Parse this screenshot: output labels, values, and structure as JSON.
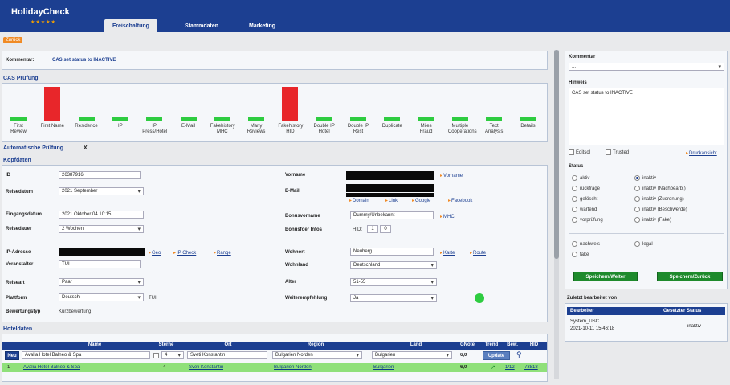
{
  "app": {
    "logo": "HolidayCheck",
    "logo_stars": "★★★★★"
  },
  "tabs": [
    "Freischaltung",
    "Stammdaten",
    "Marketing"
  ],
  "back_label": "Zurück",
  "comment_bar": {
    "label": "Kommentar:",
    "value": "CAS set status to INACTIVE"
  },
  "cas": {
    "title": "CAS Prüfung",
    "colors": {
      "ok": "#2ecc40",
      "fail": "#e8262a"
    },
    "checks": [
      {
        "label": "First Review",
        "status": "ok"
      },
      {
        "label": "First Name",
        "status": "fail"
      },
      {
        "label": "Residence",
        "status": "ok"
      },
      {
        "label": "IP",
        "status": "ok"
      },
      {
        "label": "IP Press/Hotel",
        "status": "ok"
      },
      {
        "label": "E-Mail",
        "status": "ok"
      },
      {
        "label": "Fakehistory MHC",
        "status": "ok"
      },
      {
        "label": "Many Reviews",
        "status": "ok"
      },
      {
        "label": "Fakehistory HID",
        "status": "fail"
      },
      {
        "label": "Double IP Hotel",
        "status": "ok"
      },
      {
        "label": "Double IP Rest",
        "status": "ok"
      },
      {
        "label": "Duplicate",
        "status": "ok"
      },
      {
        "label": "Miles Fraud",
        "status": "ok"
      },
      {
        "label": "Multiple Cooperations",
        "status": "ok"
      },
      {
        "label": "Text Analysis",
        "status": "ok"
      },
      {
        "label": "Details",
        "status": "ok"
      }
    ]
  },
  "auto_check": {
    "title": "Automatische Prüfung",
    "close": "X"
  },
  "kopf": {
    "title": "Kopfdaten",
    "id_label": "ID",
    "id_value": "26387916",
    "reisedatum_label": "Reisedatum",
    "reisedatum_value": "2021 September",
    "eingang_label": "Eingangsdatum",
    "eingang_value": "2021 Oktober 04 10:15",
    "reisedauer_label": "Reisedauer",
    "reisedauer_value": "2 Wochen",
    "ip_label": "IP-Adresse",
    "ip_links": [
      "Geo",
      "IP Check",
      "Range"
    ],
    "veranstalter_label": "Veranstalter",
    "veranstalter_value": "TUI",
    "reiseart_label": "Reiseart",
    "reiseart_value": "Paar",
    "plattform_label": "Plattform",
    "plattform_value": "Deutsch",
    "plattform_extra": "TUI",
    "bewertungstyp_label": "Bewertungstyp",
    "bewertungstyp_value": "Kurzbewertung",
    "vorname_label": "Vorname",
    "vorname_link": "Vorname",
    "email_label": "E-Mail",
    "email_links": [
      "Domain",
      "Link",
      "Google",
      "Facebook"
    ],
    "bonus_label": "Bonusvorname",
    "bonus_value": "Dummy/Unbekannt",
    "bonus_link": "MHC",
    "bonus_info_label": "Bonusfoer Infos",
    "bonus_info_value": "HID:",
    "bonus_info_btns": [
      "1",
      "0"
    ],
    "wohnort_label": "Wohnort",
    "wohnort_value": "Neuberg",
    "wohnort_links": [
      "Karte",
      "Route"
    ],
    "wohnland_label": "Wohnland",
    "wohnland_value": "Deutschland",
    "alter_label": "Alter",
    "alter_value": "51-55",
    "weiter_label": "Weiterempfehlung",
    "weiter_value": "Ja",
    "status_dot_color": "#2ecc40"
  },
  "hotel": {
    "title": "Hoteldaten",
    "columns": [
      "Name",
      "Sterne",
      "Ort",
      "Region",
      "Land",
      "GNote",
      "Trend",
      "Bew.",
      "HID"
    ],
    "neu_btn": "Neu",
    "edit_row": {
      "name": "Avalia Hotel Balneo & Spa",
      "stars": "4",
      "ort": "Sveti Konstantin",
      "region": "Bulgarien Norden",
      "land": "Bulgarien",
      "gnote": "6,0",
      "btn": "Update"
    },
    "data_row": {
      "marker": "1",
      "name": "Avalia Hotel Balneo & Spa",
      "stars": "4",
      "ort": "Sveti Konstantin",
      "region": "Bulgarien Norden",
      "land": "Bulgarien",
      "gnote": "6,0",
      "bew": "1/12",
      "hid": "73818"
    }
  },
  "sidebar": {
    "kommentar_title": "Kommentar",
    "kommentar_select": "...",
    "hinweis_title": "Hinweis",
    "hinweis_value": "CAS set status to INACTIVE",
    "chk_editsol": "Editsol",
    "chk_trusted": "Trusted",
    "druck_link": "Druckansicht",
    "status_title": "Status",
    "status_left": [
      "aktiv",
      "rückfrage",
      "gelöscht",
      "wartend",
      "vorprüfung"
    ],
    "status_right": [
      "inaktiv",
      "inaktiv (Nachbearb.)",
      "inaktiv (Zuordnung)",
      "inaktiv (Beschwerde)",
      "inaktiv (Fake)"
    ],
    "selected": "inaktiv",
    "extra_left": [
      "nachweis",
      "fake"
    ],
    "extra_right": [
      "legal"
    ],
    "btn_weiter": "Speichern/Weiter",
    "btn_zurueck": "Speichern/Zurück",
    "zuletzt_title": "Zuletzt bearbeitet von",
    "zuletzt_cols": [
      "Bearbeiter",
      "Gesetzter Status"
    ],
    "zuletzt_user": "System_USC",
    "zuletzt_time": "2021-10-11 15:46:18",
    "zuletzt_status": "inaktiv"
  }
}
